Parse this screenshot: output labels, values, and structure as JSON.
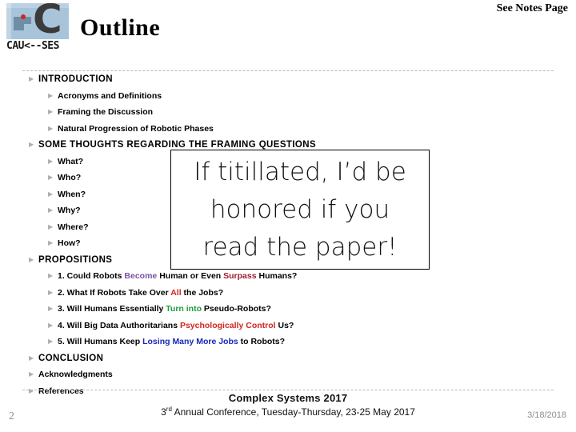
{
  "header": {
    "title": "Outline",
    "notes_link": "See Notes Page",
    "logo_letter": "C",
    "logo_text": "CAU<--SES"
  },
  "outline": [
    {
      "level": 1,
      "text": "INTRODUCTION"
    },
    {
      "level": 2,
      "text": "Acronyms and Definitions"
    },
    {
      "level": 2,
      "text": "Framing the Discussion"
    },
    {
      "level": 2,
      "text": "Natural Progression of Robotic Phases"
    },
    {
      "level": 1,
      "text": "SOME THOUGHTS REGARDING THE FRAMING QUESTIONS"
    },
    {
      "level": 2,
      "text": "What?"
    },
    {
      "level": 2,
      "text": "Who?"
    },
    {
      "level": 2,
      "text": "When?"
    },
    {
      "level": 2,
      "text": "Why?"
    },
    {
      "level": 2,
      "text": "Where?"
    },
    {
      "level": 2,
      "text": "How?"
    },
    {
      "level": 1,
      "text": "PROPOSITIONS"
    },
    {
      "level": 2,
      "rich": [
        {
          "t": "1. Could Robots ",
          "c": ""
        },
        {
          "t": "Become",
          "c": "c-purple"
        },
        {
          "t": " Human or Even ",
          "c": ""
        },
        {
          "t": "Surpass",
          "c": "c-crimson"
        },
        {
          "t": " Humans?",
          "c": ""
        }
      ]
    },
    {
      "level": 2,
      "rich": [
        {
          "t": "2. What If Robots Take Over ",
          "c": ""
        },
        {
          "t": "All",
          "c": "c-red"
        },
        {
          "t": " the Jobs?",
          "c": ""
        }
      ]
    },
    {
      "level": 2,
      "rich": [
        {
          "t": "3. Will Humans Essentially ",
          "c": ""
        },
        {
          "t": "Turn into",
          "c": "c-green"
        },
        {
          "t": " Pseudo-Robots?",
          "c": ""
        }
      ]
    },
    {
      "level": 2,
      "rich": [
        {
          "t": "4. Will Big Data Authoritarians ",
          "c": ""
        },
        {
          "t": "Psychologically",
          "c": "c-red"
        },
        {
          "t": " ",
          "c": ""
        },
        {
          "t": "Control",
          "c": "c-red"
        },
        {
          "t": " Us?",
          "c": ""
        }
      ]
    },
    {
      "level": 2,
      "rich": [
        {
          "t": "5. Will Humans Keep ",
          "c": ""
        },
        {
          "t": "Losing Many More Jobs",
          "c": "c-blue"
        },
        {
          "t": " to Robots?",
          "c": ""
        }
      ]
    },
    {
      "level": 1,
      "text": "CONCLUSION"
    },
    {
      "level": 1,
      "small": true,
      "text": "Acknowledgments"
    },
    {
      "level": 1,
      "small": true,
      "text": "References"
    }
  ],
  "callout": {
    "line1": "If titillated, I’d be",
    "line2": "honored if you",
    "line3": "read the paper!"
  },
  "footer": {
    "page_number": "2",
    "conference_title": "Complex Systems 2017",
    "conference_subtitle_pre": "3",
    "conference_subtitle_sup": "rd",
    "conference_subtitle_post": " Annual Conference, Tuesday-Thursday, 23-25 May 2017",
    "date_stamp": "3/18/2018"
  },
  "colors": {
    "purple": "#7a52a1",
    "crimson": "#9e1b32",
    "red": "#d2231e",
    "green": "#1f9c3c",
    "blue": "#1a26bb",
    "bullet_gray": "#aeaeae",
    "rule_gray": "#b9b9b9",
    "footer_gray": "#8d8d8d",
    "logo_blue": "#a8c4da"
  }
}
